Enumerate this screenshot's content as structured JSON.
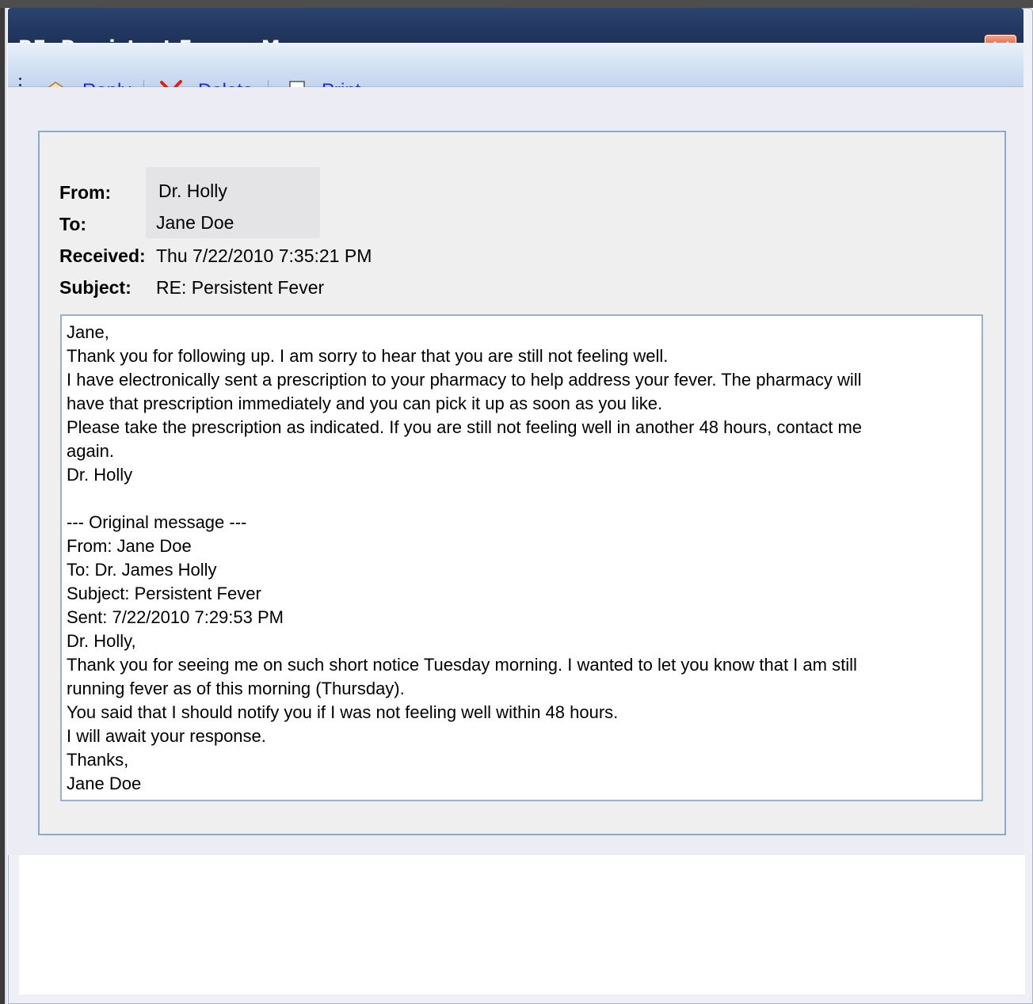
{
  "window": {
    "title": "RE: Persistent Fever - Message"
  },
  "toolbar": {
    "reply_label": "Reply",
    "delete_label": "Delete",
    "print_label": "Print"
  },
  "header": {
    "from_label": "From:",
    "from_value": "Dr. Holly",
    "to_label": "To:",
    "to_value": "Jane Doe",
    "received_label": "Received:",
    "received_value": "Thu 7/22/2010 7:35:21 PM",
    "subject_label": "Subject:",
    "subject_value": "RE: Persistent Fever"
  },
  "body": {
    "lines": [
      "Jane,",
      "Thank you for following up. I am sorry to hear that you are still not feeling well.",
      "I have electronically sent a prescription to your pharmacy to help address your fever. The pharmacy will",
      "have that prescription immediately and you can pick it up as soon as you like.",
      "Please take the prescription as indicated. If you are still not feeling well in another 48 hours, contact me",
      "again.",
      "Dr. Holly",
      "",
      "--- Original message ---",
      "From: Jane Doe",
      "To: Dr. James Holly",
      "Subject: Persistent Fever",
      "Sent: 7/22/2010 7:29:53 PM",
      "Dr. Holly,",
      "Thank you for seeing me on such short notice Tuesday morning. I wanted to let you know that I am still",
      "running fever as of this morning (Thursday).",
      "You said that I should notify you if I was not feeling well within 48 hours.",
      "I will await your response.",
      "Thanks,",
      "Jane Doe"
    ]
  },
  "colors": {
    "titlebar": "#243a64",
    "link": "#1a2bd6",
    "close_button": "#e0532e",
    "panel_border": "#90a8cc"
  },
  "icons": {
    "reply": "reply-icon",
    "delete": "delete-x-icon",
    "print": "printer-icon",
    "close": "close-icon"
  }
}
